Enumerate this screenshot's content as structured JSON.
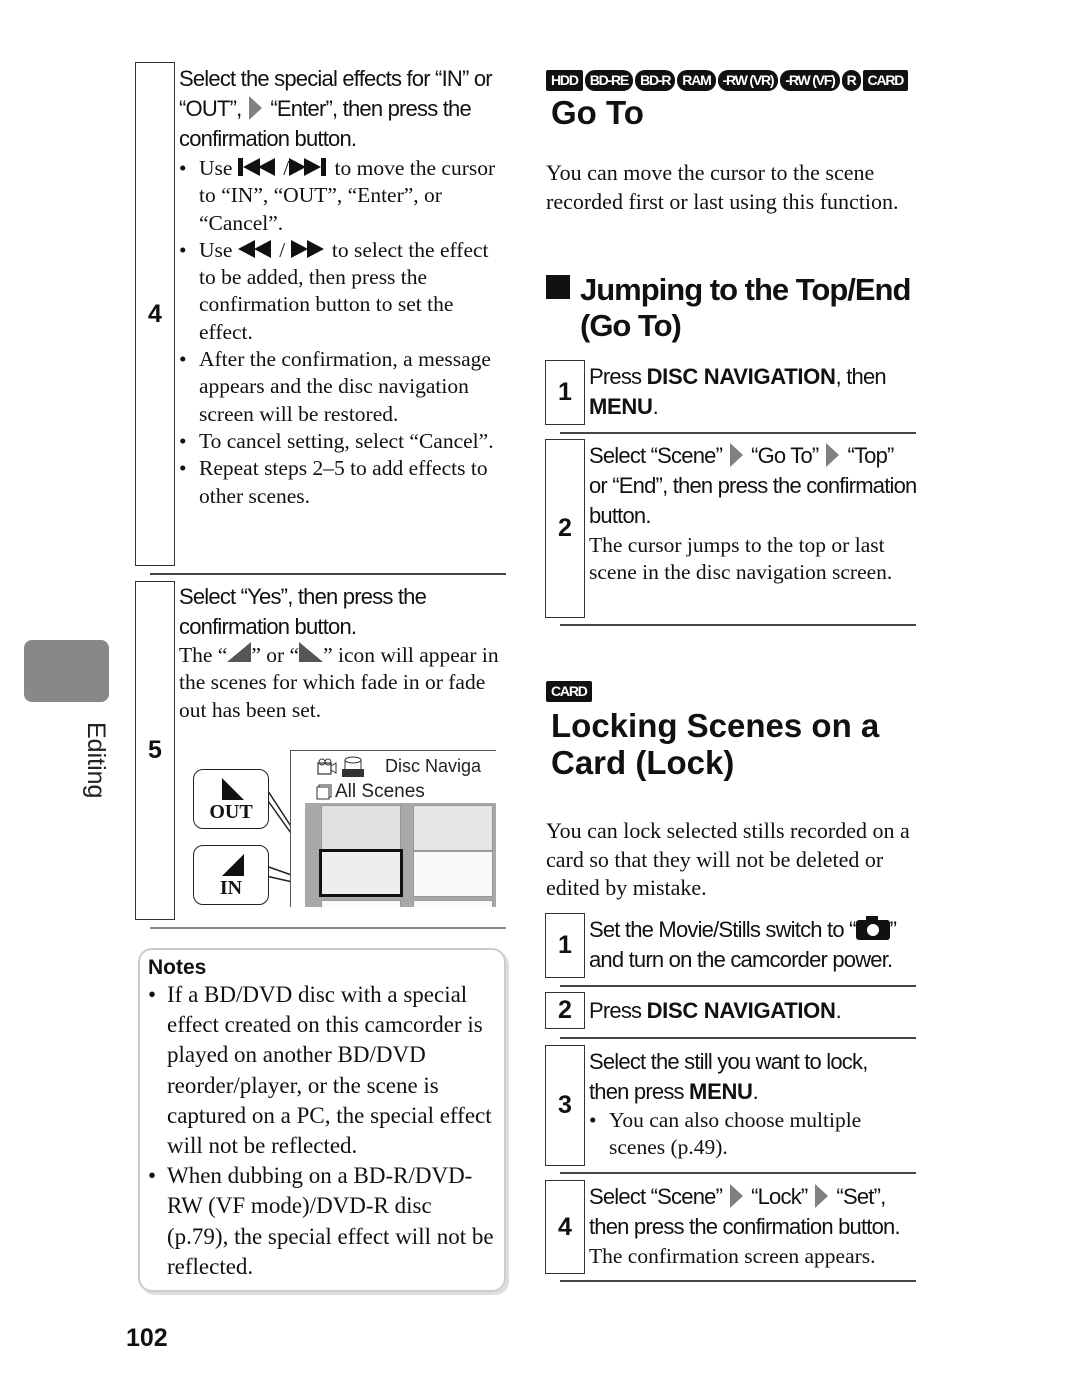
{
  "side_tab": {
    "label": "Editing",
    "color": "#888888"
  },
  "page_number": "102",
  "left": {
    "step4": {
      "number": "4",
      "heading_parts": [
        "Select the special effects for “IN” or",
        "“OUT”,",
        "“Enter”, then press the",
        "confirmation button."
      ],
      "bullets": [
        {
          "pre": "Use",
          "icons": [
            "skip-back-icon",
            "skip-forward-icon"
          ],
          "post": "to move the cursor to “IN”, “OUT”, “Enter”, or “Cancel”."
        },
        {
          "pre": "Use",
          "icons": [
            "rewind-icon",
            "fast-forward-icon"
          ],
          "post": "to select the effect to be added, then press the confirmation button to set the effect."
        },
        {
          "text": "After the confirmation, a message appears and the disc navigation screen will be restored."
        },
        {
          "text": "To cancel setting, select “Cancel”."
        },
        {
          "text": "Repeat steps 2–5 to add effects to other scenes."
        }
      ]
    },
    "step5": {
      "number": "5",
      "heading": "Select “Yes”, then press the confirmation button.",
      "body_pre": "The “",
      "body_mid": "” or “",
      "body_post": "” icon will appear in the scenes for which fade in or fade out has been set.",
      "illustration": {
        "callout_out": "OUT",
        "callout_in": "IN",
        "screen_title": "Disc  Naviga",
        "screen_subtitle": "All Scenes"
      }
    },
    "notes": {
      "title": "Notes",
      "items": [
        "If a BD/DVD disc with a special effect created on this camcorder is played on another BD/DVD reorder/player, or the scene is captured on a PC, the special effect will not be reflected.",
        "When dubbing on a BD-R/DVD-RW (VF mode)/DVD-R disc (p.79), the special effect will not be reflected."
      ]
    }
  },
  "right": {
    "media_badges": [
      "HDD",
      "BD-RE",
      "BD-R",
      "RAM",
      "-RW (VR)",
      "-RW (VF)",
      "R",
      "CARD"
    ],
    "goto": {
      "title": "Go To",
      "intro": "You can move the cursor to the scene recorded first or last using this function.",
      "section_heading_line1": "Jumping to the Top/End",
      "section_heading_line2": "(Go To)",
      "steps": [
        {
          "number": "1",
          "pre": "Press ",
          "b1": "DISC NAVIGATION",
          "mid": ", then ",
          "b2": "MENU",
          "post": "."
        },
        {
          "number": "2",
          "p1": "Select “Scene”",
          "p2": "“Go To”",
          "p3": "“Top”",
          "p4": "or “End”, then press the confirmation button.",
          "body": "The cursor jumps to the top or last scene in the disc navigation screen."
        }
      ]
    },
    "lock": {
      "badge": "CARD",
      "title_line1": "Locking Scenes on a",
      "title_line2": "Card (Lock)",
      "intro": "You can lock selected stills recorded on a card so that they will not be deleted or edited by mistake.",
      "steps": [
        {
          "number": "1",
          "pre": "Set the Movie/Stills switch to “",
          "icon": "camera-icon",
          "post": "” and turn on the camcorder power."
        },
        {
          "number": "2",
          "pre": "Press ",
          "b1": "DISC NAVIGATION",
          "post": "."
        },
        {
          "number": "3",
          "pre": "Select the still you want to lock, then press ",
          "b1": "MENU",
          "post": ".",
          "bullet": "You can also choose multiple scenes (p.49)."
        },
        {
          "number": "4",
          "p1": "Select “Scene”",
          "p2": "“Lock”",
          "p3": "“Set”,",
          "p4": "then press the confirmation button.",
          "body": "The confirmation screen appears."
        }
      ]
    }
  }
}
